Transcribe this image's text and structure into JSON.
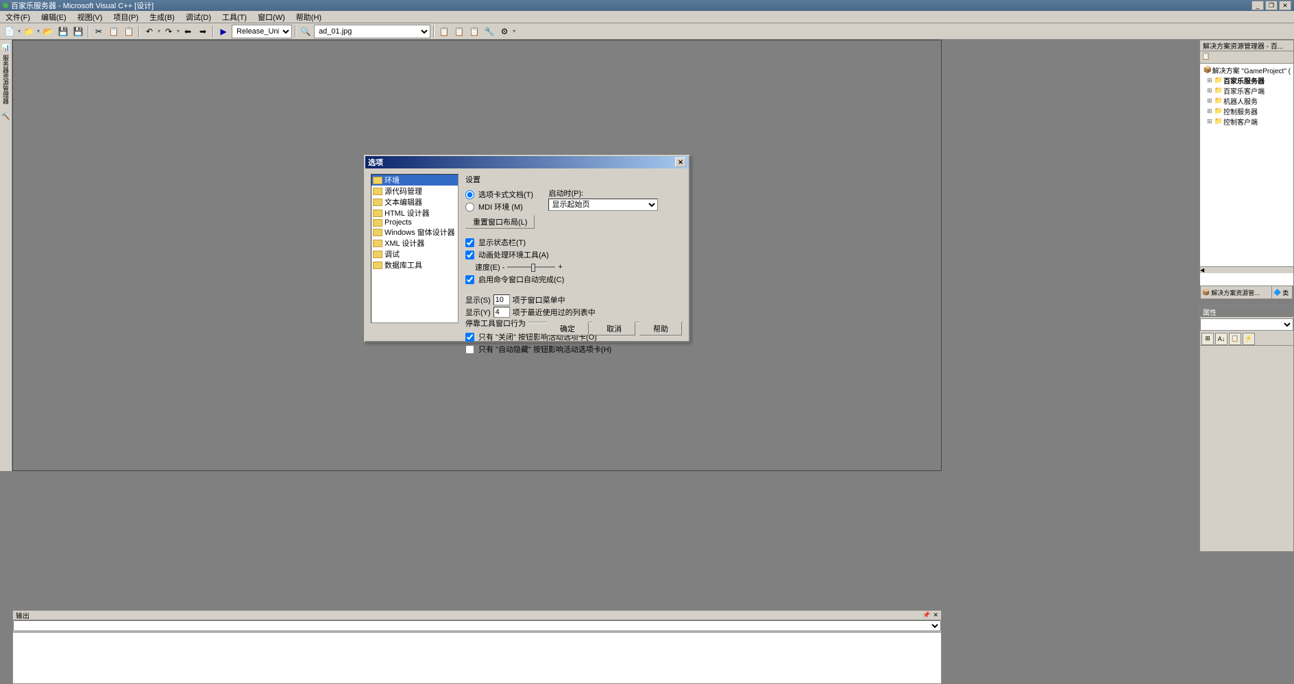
{
  "titlebar": {
    "text": "百家乐服务器 - Microsoft Visual C++ [设计]"
  },
  "menu": {
    "items": [
      "文件(F)",
      "编辑(E)",
      "视图(V)",
      "项目(P)",
      "生成(B)",
      "调试(D)",
      "工具(T)",
      "窗口(W)",
      "帮助(H)"
    ]
  },
  "toolbar": {
    "config": "Release_Unicode",
    "find": "ad_01.jpg"
  },
  "solution_panel": {
    "title": "解决方案资源管理器 - 百...",
    "root": "解决方案 \"GameProject\" (",
    "items": [
      "百家乐服务器",
      "百家乐客户端",
      "机器人服务",
      "控制服务器",
      "控制客户端"
    ],
    "tab1": "解决方案资源管...",
    "tab2": "类"
  },
  "props_panel": {
    "title": "属性"
  },
  "output_panel": {
    "title": "输出"
  },
  "dialog": {
    "title": "选项",
    "tree": [
      "环境",
      "源代码管理",
      "文本编辑器",
      "HTML 设计器",
      "Projects",
      "Windows 窗体设计器",
      "XML 设计器",
      "调试",
      "数据库工具"
    ],
    "settings_label": "设置",
    "radio_tab": "选项卡式文档(T)",
    "radio_mdi": "MDI 环境 (M)",
    "startup_label": "启动时(P):",
    "startup_value": "显示起始页",
    "reset_btn": "重置窗口布局(L)",
    "chk_status": "显示状态栏(T)",
    "chk_anim": "动画处理环境工具(A)",
    "speed_label": "速度(E) -",
    "speed_plus": "+",
    "chk_cmd": "启用命令窗口自动完成(C)",
    "show1_label": "显示(S)",
    "show1_val": "10",
    "show1_suffix": "项于窗口菜单中",
    "show2_label": "显示(Y)",
    "show2_val": "4",
    "show2_suffix": "项于最近使用过的列表中",
    "group_dock": "停靠工具窗口行为",
    "chk_close": "只有 \"关闭\" 按钮影响活动选项卡(O)",
    "chk_autohide": "只有 \"自动隐藏\" 按钮影响活动选项卡(H)",
    "btn_ok": "确定",
    "btn_cancel": "取消",
    "btn_help": "帮助"
  }
}
